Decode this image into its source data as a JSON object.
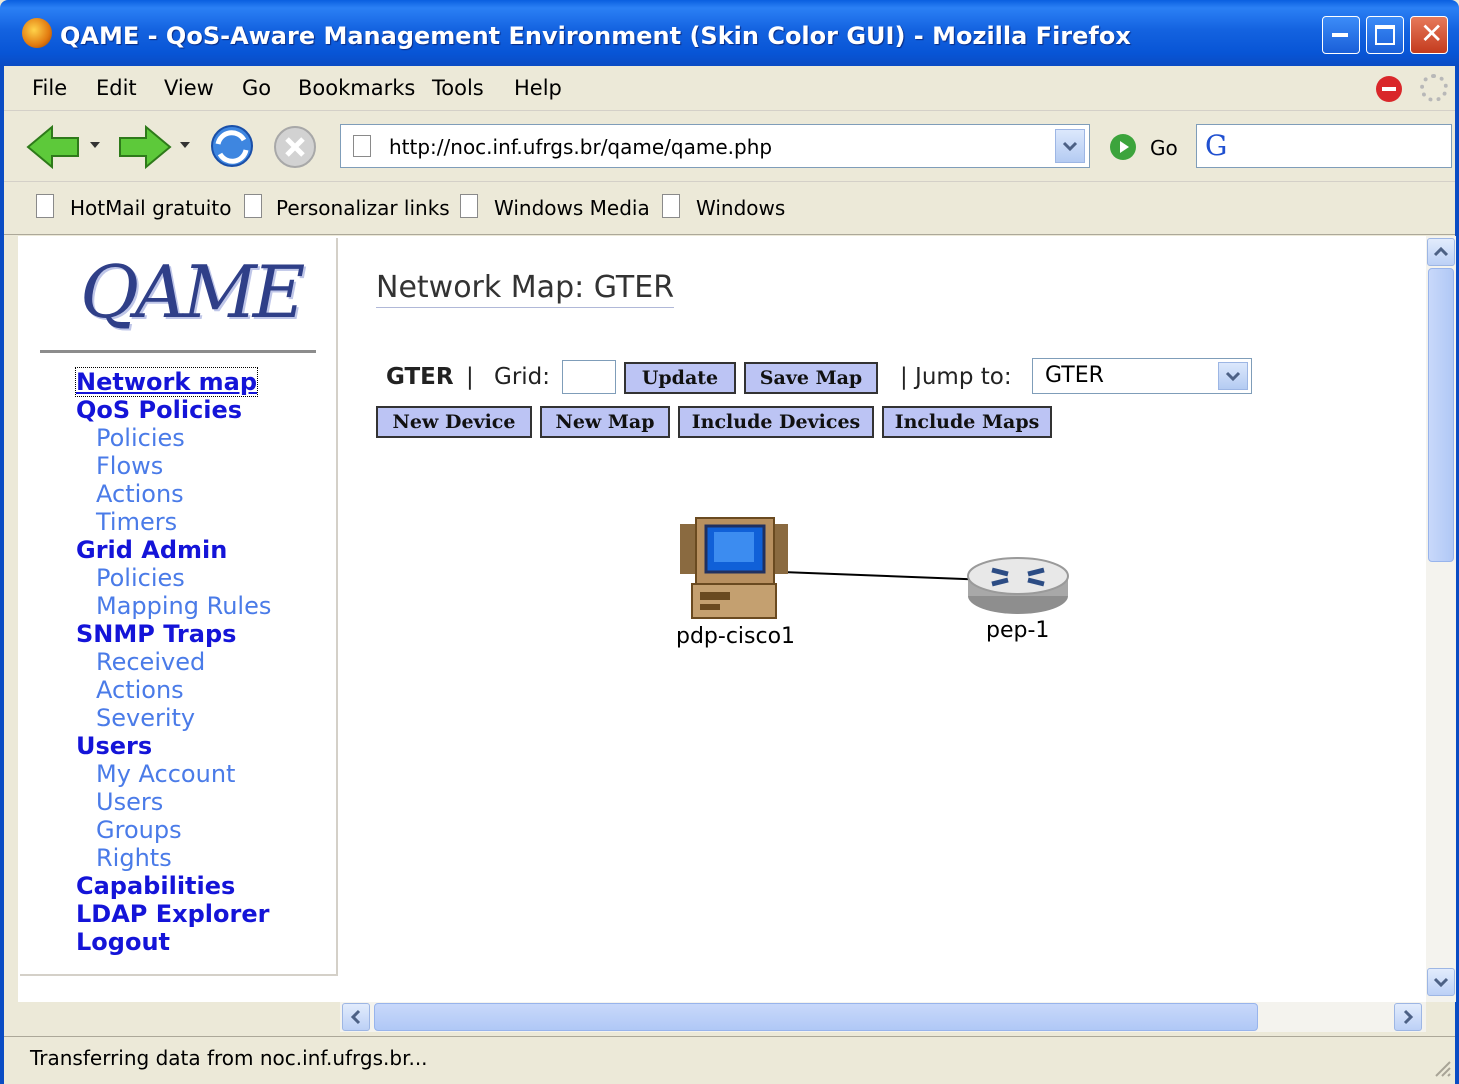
{
  "window": {
    "title": "QAME - QoS-Aware Management Environment (Skin Color GUI) - Mozilla Firefox"
  },
  "menu": [
    "File",
    "Edit",
    "View",
    "Go",
    "Bookmarks",
    "Tools",
    "Help"
  ],
  "navbar": {
    "url": "http://noc.inf.ufrgs.br/qame/qame.php",
    "go_label": "Go",
    "search_logo": "G"
  },
  "bookmarks": [
    "HotMail gratuito",
    "Personalizar links",
    "Windows Media",
    "Windows"
  ],
  "sidebar": {
    "logo": "QAME",
    "items": [
      {
        "label": "Network map",
        "level": "header",
        "active": true
      },
      {
        "label": "QoS Policies",
        "level": "header"
      },
      {
        "label": "Policies",
        "level": "sub"
      },
      {
        "label": "Flows",
        "level": "sub"
      },
      {
        "label": "Actions",
        "level": "sub"
      },
      {
        "label": "Timers",
        "level": "sub"
      },
      {
        "label": "Grid Admin",
        "level": "header"
      },
      {
        "label": "Policies",
        "level": "sub"
      },
      {
        "label": "Mapping Rules",
        "level": "sub"
      },
      {
        "label": "SNMP Traps",
        "level": "header"
      },
      {
        "label": "Received",
        "level": "sub"
      },
      {
        "label": "Actions",
        "level": "sub"
      },
      {
        "label": "Severity",
        "level": "sub"
      },
      {
        "label": "Users",
        "level": "header"
      },
      {
        "label": "My Account",
        "level": "sub"
      },
      {
        "label": "Users",
        "level": "sub"
      },
      {
        "label": "Groups",
        "level": "sub"
      },
      {
        "label": "Rights",
        "level": "sub"
      },
      {
        "label": "Capabilities",
        "level": "header"
      },
      {
        "label": "LDAP Explorer",
        "level": "header"
      },
      {
        "label": "Logout",
        "level": "header"
      }
    ]
  },
  "main": {
    "title": "Network Map: GTER",
    "map_name": "GTER",
    "separator": "|",
    "grid_label": "Grid:",
    "grid_value": "",
    "update_label": "Update",
    "save_map_label": "Save Map",
    "jump_label": "| Jump to:",
    "jump_value": "GTER",
    "new_device_label": "New Device",
    "new_map_label": "New Map",
    "include_devices_label": "Include Devices",
    "include_maps_label": "Include Maps",
    "devices": [
      {
        "name": "pdp-cisco1",
        "icon": "computer-icon"
      },
      {
        "name": "pep-1",
        "icon": "router-icon"
      }
    ]
  },
  "status": {
    "text": "Transferring data from noc.inf.ufrgs.br..."
  },
  "colors": {
    "titlebar": "#0A5FE0",
    "nav_header": "#1414D8",
    "nav_sub": "#4A7BE8",
    "button_bg": "#BCC4F4"
  }
}
